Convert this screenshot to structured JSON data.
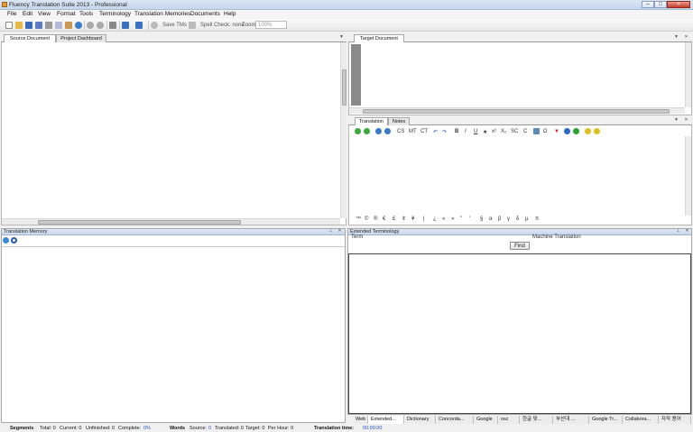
{
  "window": {
    "title": "Fluency Translation Suite 2013 - Professional",
    "min": "–",
    "max": "□",
    "close": "×"
  },
  "menu": [
    "File",
    "Edit",
    "View",
    "Format",
    "Tools",
    "Terminology",
    "Translation Memories",
    "Documents",
    "Help"
  ],
  "toolbar": {
    "save_tms": "Save TMs",
    "spell_check": "Spell Check: none",
    "zoom_label": "Zoom",
    "zoom_value": "100%"
  },
  "left_tabs": [
    "Source Document",
    "Project Dashboard"
  ],
  "target_tab": "Target Document",
  "translation_tabs": [
    "Translation",
    "Notes"
  ],
  "format_buttons": [
    "CS",
    "MT",
    "CT",
    "B",
    "I",
    "U",
    "★",
    "x²",
    "X₂",
    "SC",
    "C",
    "Ω"
  ],
  "special_chars": [
    "™",
    "©",
    "®",
    "€",
    "£",
    "¢",
    "¥",
    "|",
    "¿",
    "«",
    "»",
    "\"",
    "'",
    "§",
    "α",
    "β",
    "γ",
    "δ",
    "µ",
    "π"
  ],
  "tm_panel": {
    "title": "Translation Memory"
  },
  "ext_term_panel": {
    "title": "Extended Terminology",
    "col_term": "Term",
    "col_mt": "Machine Translation",
    "find": "Find"
  },
  "bottom_tabs": [
    "Web",
    "Extended...",
    "Dictionary",
    "Concorda...",
    "Google",
    "osc",
    "한글 맞...",
    "부산대 ...",
    "Google Tr...",
    "Collabora...",
    "자작 용어"
  ],
  "status": {
    "segments_label": "Segments",
    "total": "Total: 0",
    "current": "Current: 0",
    "unfinished": "Unfinished: 0",
    "complete_label": "Complete:",
    "complete_val": "0%",
    "words_label": "Words",
    "source_label": "Source:",
    "source_val": "0",
    "translated": "Translated: 0",
    "target": "Target: 0",
    "per_hour": "Per Hour: 0",
    "time_label": "Translation time:",
    "time_val": "00:00:00"
  },
  "colors": {
    "accent": "#2a56c6",
    "panel_head": "#c9d7ec"
  }
}
